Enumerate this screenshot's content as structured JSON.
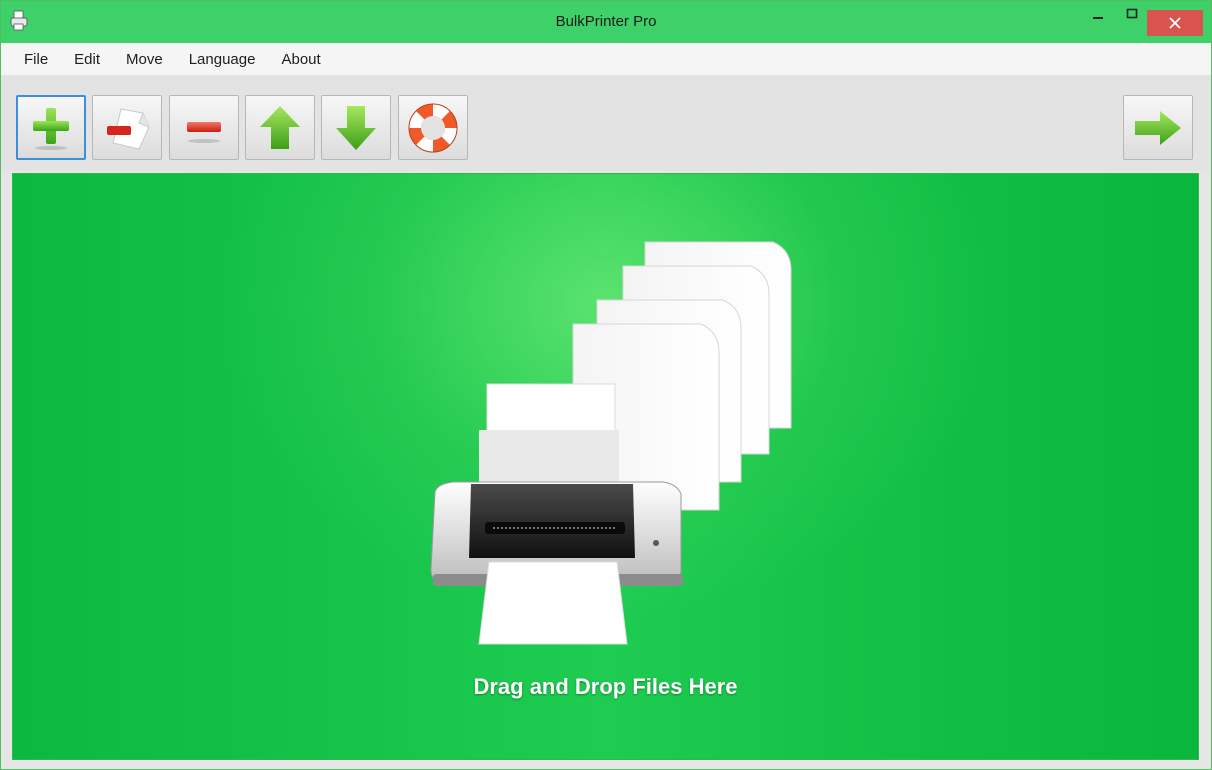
{
  "window": {
    "title": "BulkPrinter Pro",
    "app_icon": "printer-icon",
    "controls": [
      "minimize-icon",
      "maximize-icon",
      "close-icon"
    ]
  },
  "menu": {
    "items": [
      "File",
      "Edit",
      "Move",
      "Language",
      "About"
    ]
  },
  "toolbar": {
    "buttons": [
      {
        "icon": "add-icon",
        "active": true
      },
      {
        "icon": "remove-document-icon"
      },
      {
        "icon": "remove-icon"
      },
      {
        "icon": "arrow-up-icon"
      },
      {
        "icon": "arrow-down-icon"
      },
      {
        "icon": "help-lifebuoy-icon"
      }
    ],
    "next_button": {
      "icon": "arrow-right-icon"
    }
  },
  "drop_area": {
    "text": "Drag and Drop Files Here",
    "illustration": "printer-with-pages-icon"
  },
  "colors": {
    "titlebar": "#3ed16a",
    "accent_green": "#1fcc52",
    "close_button": "#d9534f",
    "focus_border": "#3f8fd6"
  }
}
